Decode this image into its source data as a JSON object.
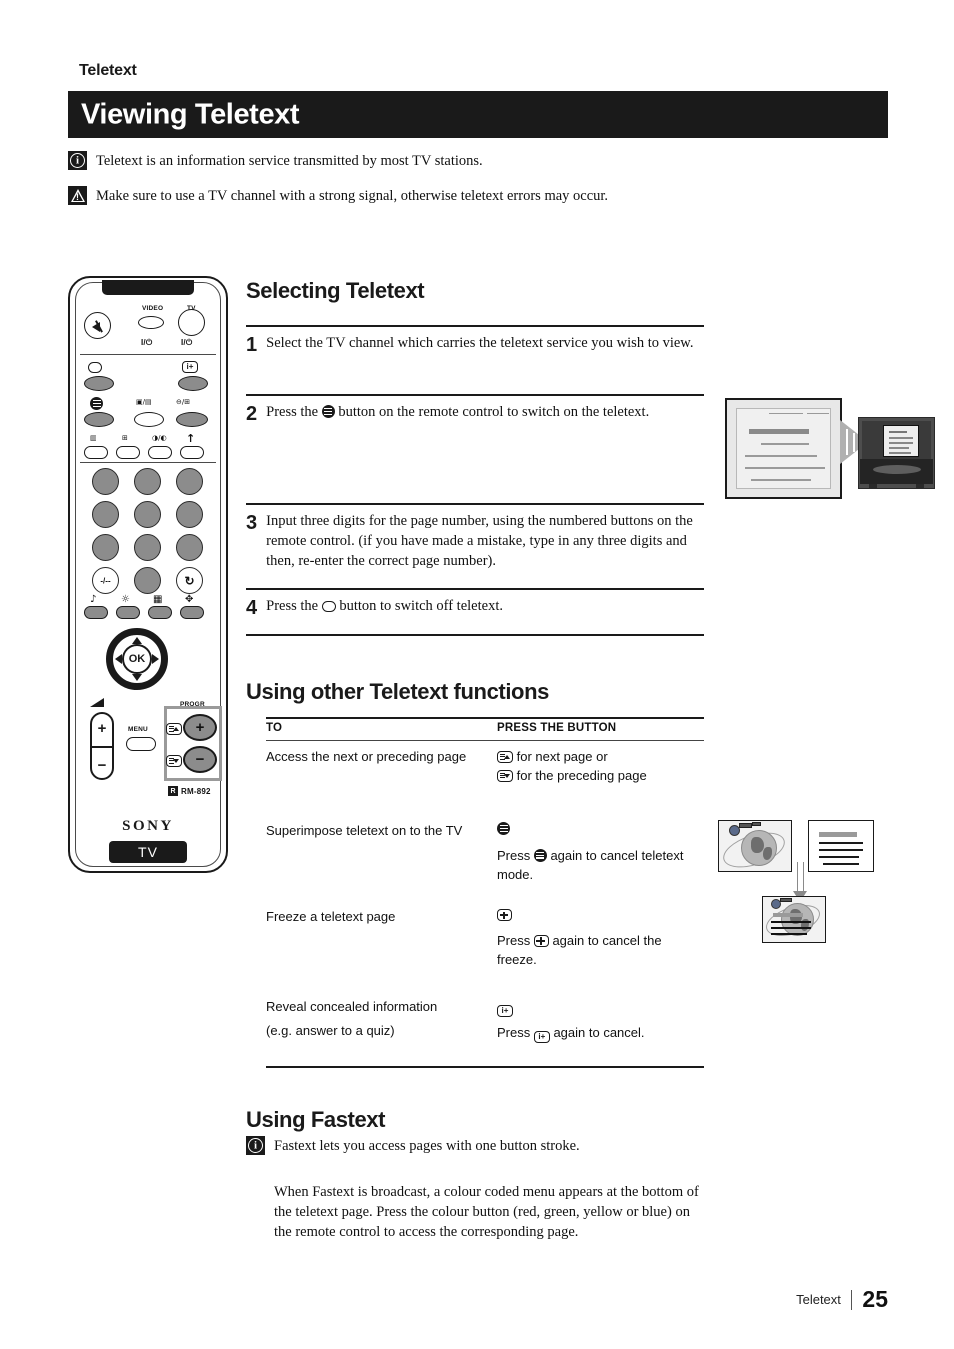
{
  "header": {
    "eyebrow": "Teletext",
    "title": "Viewing Teletext"
  },
  "notes": [
    {
      "icon": "info-icon",
      "text": "Teletext is an information service transmitted by most TV stations."
    },
    {
      "icon": "warning-icon",
      "text": "Make sure to use a TV channel with a strong signal, otherwise teletext errors may occur."
    }
  ],
  "remote": {
    "label_video": "VIDEO",
    "label_tv": "TV",
    "power_video": "I/⏻",
    "power_tv": "I/⏻",
    "ok_label": "OK",
    "menu_label": "MENU",
    "progr_label": "PROGR",
    "progr_plus": "+",
    "progr_minus": "−",
    "volume_plus": "+",
    "volume_minus": "−",
    "model_mark": "R",
    "model_number": "RM-892",
    "brand": "SONY",
    "mode_badge": "TV",
    "keypad_special": {
      "dash": "-/--",
      "recall": "↻"
    }
  },
  "selecting": {
    "heading": "Selecting Teletext",
    "steps": [
      {
        "num": "1",
        "text_before": "Select the TV channel which carries the teletext service you wish to view.",
        "icon": "",
        "text_after": ""
      },
      {
        "num": "2",
        "text_before": "Press the ",
        "icon": "teletext-icon",
        "text_after": " button on the remote control to switch on the teletext."
      },
      {
        "num": "3",
        "text_before": "Input three digits for the page number, using the numbered buttons on the remote control. (if you have made a mistake, type in any three digits and then, re-enter the correct page number).",
        "icon": "",
        "text_after": ""
      },
      {
        "num": "4",
        "text_before": "Press the ",
        "icon": "teletext-off-icon",
        "text_after": " button to switch off teletext."
      }
    ]
  },
  "functions": {
    "heading": "Using other Teletext functions",
    "columns": [
      "TO",
      "PRESS THE BUTTON"
    ],
    "rows": [
      {
        "to": "Access the next or preceding page",
        "lines": [
          {
            "icon": "page-up-icon",
            "text": " for next page or"
          },
          {
            "icon": "page-down-icon",
            "text": " for the preceding page"
          }
        ]
      },
      {
        "to": "Superimpose teletext on to the TV",
        "lines": [
          {
            "icon": "teletext-icon",
            "text": ""
          },
          {
            "icon": "",
            "text": "Press "
          },
          {
            "icon": "teletext-icon",
            "text": " again to cancel teletext mode."
          }
        ]
      },
      {
        "to": "Freeze a teletext page",
        "lines": [
          {
            "icon": "freeze-icon",
            "text": ""
          },
          {
            "icon": "",
            "text": "Press "
          },
          {
            "icon": "freeze-icon",
            "text": " again to cancel the freeze."
          }
        ]
      },
      {
        "to": "Reveal concealed information",
        "to_line2": "(e.g. answer to a quiz)",
        "lines": [
          {
            "icon": "reveal-icon",
            "text": ""
          },
          {
            "icon": "",
            "text": "Press "
          },
          {
            "icon": "reveal-icon",
            "text": " again to cancel."
          }
        ]
      }
    ]
  },
  "fastext": {
    "heading": "Using Fastext",
    "note": "Fastext lets you access pages with one button stroke.",
    "paragraph": "When Fastext is broadcast, a colour coded menu appears at the bottom of the teletext page. Press the colour button (red, green, yellow or blue) on the remote control to access the corresponding page."
  },
  "footer": {
    "label": "Teletext",
    "page": "25"
  },
  "colors": {
    "title_bar": "#1a1a1a",
    "text": "#111111",
    "button_gray": "#8c8c8c",
    "illustration_gray": "#9a9a9a"
  }
}
